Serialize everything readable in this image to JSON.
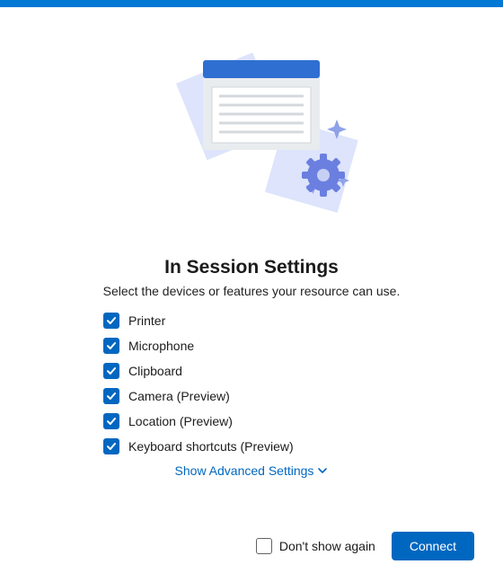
{
  "title": "In Session Settings",
  "subtitle": "Select the devices or features your resource can use.",
  "options": [
    {
      "label": "Printer",
      "checked": true
    },
    {
      "label": "Microphone",
      "checked": true
    },
    {
      "label": "Clipboard",
      "checked": true
    },
    {
      "label": "Camera (Preview)",
      "checked": true
    },
    {
      "label": "Location (Preview)",
      "checked": true
    },
    {
      "label": "Keyboard shortcuts (Preview)",
      "checked": true
    }
  ],
  "advanced_label": "Show Advanced Settings",
  "dont_show_label": "Don't show again",
  "dont_show_checked": false,
  "connect_label": "Connect"
}
